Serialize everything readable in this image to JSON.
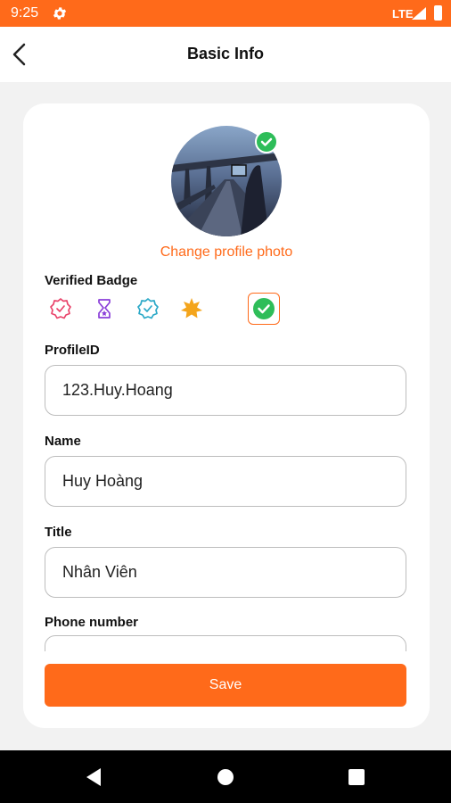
{
  "status_bar": {
    "time": "9:25",
    "network": "LTE"
  },
  "header": {
    "title": "Basic Info"
  },
  "profile": {
    "change_photo_label": "Change profile photo"
  },
  "verified_badge": {
    "label": "Verified Badge",
    "options": [
      {
        "icon": "badge-check-outline-icon",
        "color": "#e9436a"
      },
      {
        "icon": "hourglass-star-icon",
        "color": "#8b3fd9"
      },
      {
        "icon": "badge-check-outline-icon",
        "color": "#2aa8c7"
      },
      {
        "icon": "star-burst-icon",
        "color": "#f4a51c"
      },
      {
        "icon": "check-circle-icon",
        "color": "#2ebd59",
        "selected": true
      }
    ]
  },
  "form": {
    "profile_id": {
      "label": "ProfileID",
      "value": "123.Huy.Hoang"
    },
    "name": {
      "label": "Name",
      "value": "Huy Hoàng"
    },
    "title": {
      "label": "Title",
      "value": "Nhân Viên"
    },
    "phone": {
      "label": "Phone number",
      "value": ""
    }
  },
  "actions": {
    "save_label": "Save"
  },
  "colors": {
    "accent": "#ff6a1a",
    "verified": "#2ebd59"
  }
}
